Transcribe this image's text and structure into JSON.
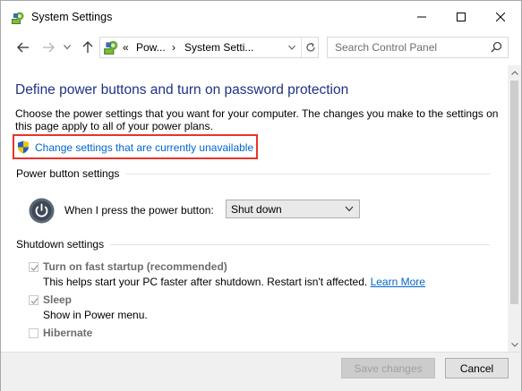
{
  "window": {
    "title": "System Settings",
    "minimize_glyph": "—",
    "maximize_glyph": "☐",
    "close_glyph": "✕"
  },
  "address": {
    "separator": "«",
    "crumb_1": "Pow...",
    "arrow_1": "›",
    "crumb_2": "System Setti...",
    "arrow_2": "›",
    "search_placeholder": "Search Control Panel"
  },
  "page": {
    "heading": "Define power buttons and turn on password protection",
    "description": "Choose the power settings that you want for your computer. The changes you make to the settings on this page apply to all of your power plans.",
    "change_link": "Change settings that are currently unavailable"
  },
  "power_button": {
    "section_label": "Power button settings",
    "label": "When I press the power button:",
    "selected": "Shut down"
  },
  "shutdown": {
    "section_label": "Shutdown settings",
    "items": [
      {
        "label": "Turn on fast startup (recommended)",
        "checked": true,
        "description": "This helps start your PC faster after shutdown. Restart isn't affected.",
        "link": "Learn More"
      },
      {
        "label": "Sleep",
        "checked": true,
        "description": "Show in Power menu."
      },
      {
        "label": "Hibernate",
        "checked": false
      }
    ]
  },
  "footer": {
    "save_label": "Save changes",
    "cancel_label": "Cancel"
  },
  "colors": {
    "heading": "#1e3287",
    "link": "#0066cc",
    "highlight_box": "#e8342c"
  }
}
